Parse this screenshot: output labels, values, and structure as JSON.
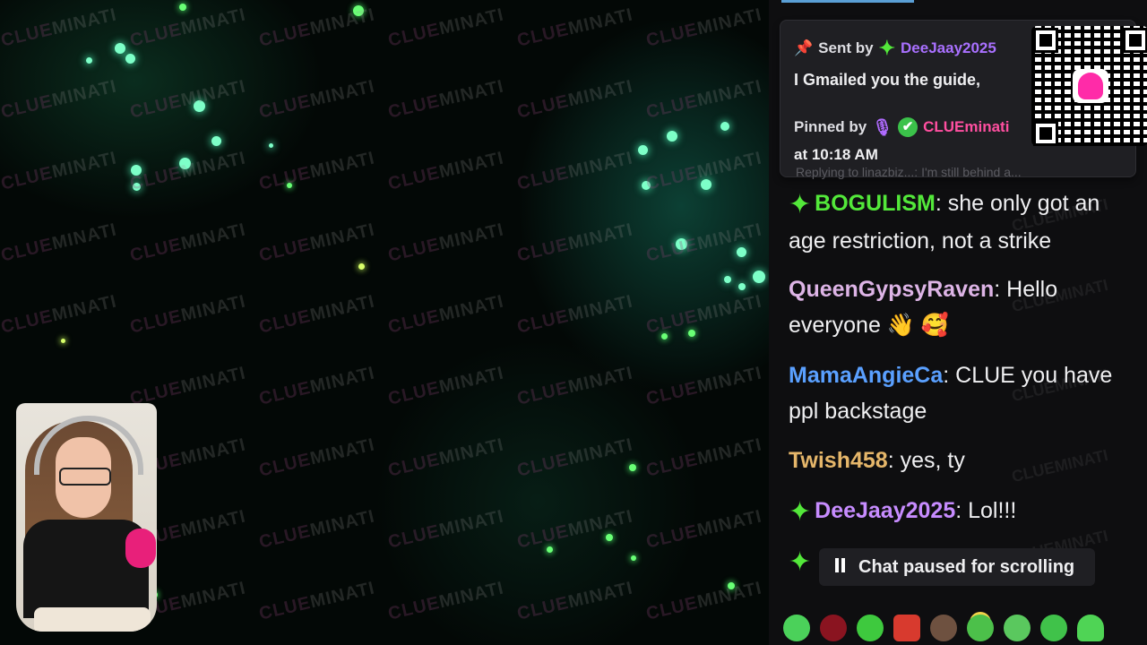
{
  "stream": {
    "watermark_part1": "CLUE",
    "watermark_part2": "MINATI"
  },
  "chat": {
    "pinned": {
      "sent_by_prefix": "Sent by",
      "sent_by_user": "DeeJaay2025",
      "message": "I Gmailed you the guide,",
      "pinned_by_prefix": "Pinned by",
      "pinned_by_user": "CLUEminati",
      "time": "at 10:18 AM"
    },
    "faded_reply": "Replying to linazbiz...: I'm still behind a...",
    "messages": [
      {
        "user": "BOGULISM",
        "text": ": she only got an age restriction, not a strike",
        "color": "#53e83a",
        "badge": "sparkle"
      },
      {
        "user": "QueenGypsyRaven",
        "text": ": Hello everyone 👋 🥰",
        "color": "#ddb4e6",
        "badge": ""
      },
      {
        "user": "MamaAngieCa",
        "text": ": CLUE you have ppl backstage",
        "color": "#5aa0ff",
        "badge": ""
      },
      {
        "user": "Twish458",
        "text": ": yes, ty",
        "color": "#e5b66a",
        "badge": ""
      },
      {
        "user": "DeeJaay2025",
        "text": ": Lol!!!",
        "color": "#c78cff",
        "badge": "sparkle"
      }
    ],
    "paused_label": "Chat paused for scrolling",
    "colors": {
      "panel_bg": "#0e0e10",
      "pinned_bg": "#1f1f23",
      "accent_purple": "#a970ff",
      "sparkle_green": "#53e83a"
    },
    "emotes": [
      "green-alien-emote",
      "red-demon-emote",
      "green-grin-emote",
      "red-angry-emote",
      "pug-emote",
      "halo-emote",
      "green-frog-emote",
      "green-blob-emote",
      "green-ghost-emote"
    ]
  }
}
